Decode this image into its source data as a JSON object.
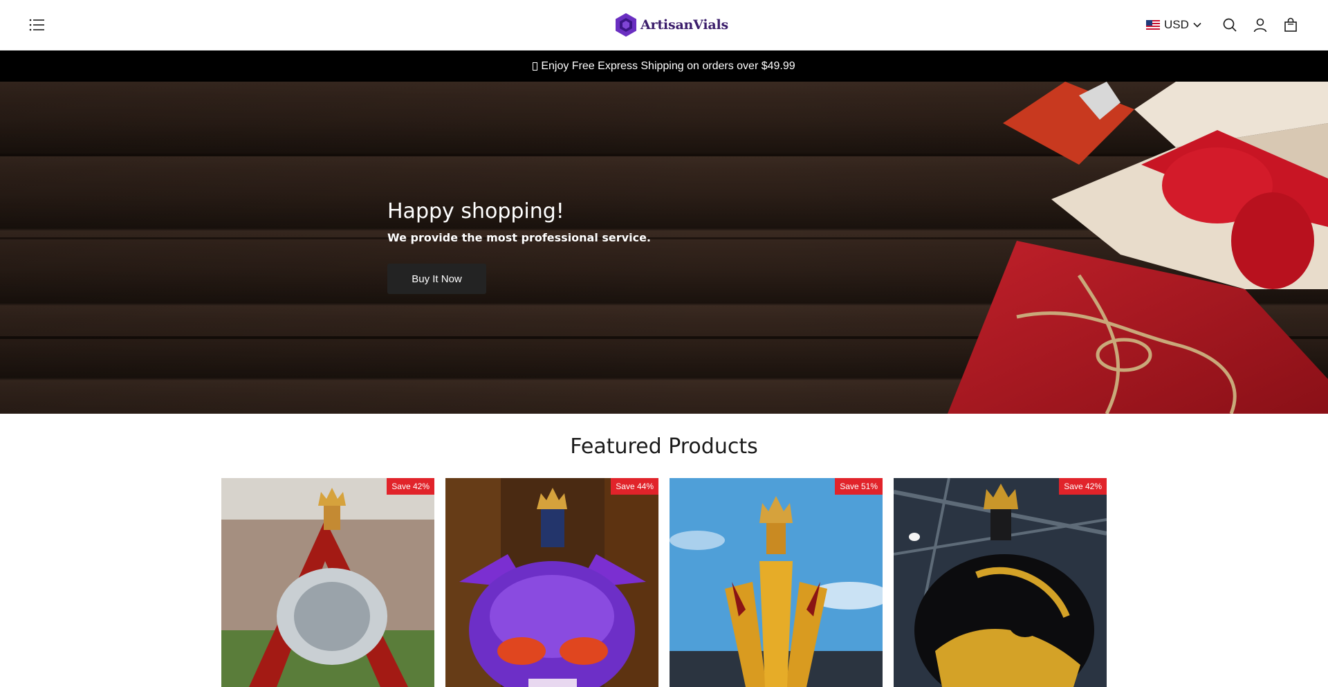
{
  "header": {
    "logo_text": "ArtisanVials",
    "currency": "USD",
    "icons": [
      "menu-icon",
      "us-flag-icon",
      "chevron-down-icon",
      "search-icon",
      "account-icon",
      "cart-icon"
    ]
  },
  "announcement": {
    "text": "Enjoy Free Express Shipping on orders over $49.99"
  },
  "hero": {
    "title": "Happy shopping!",
    "subtitle": "We provide the most professional service.",
    "button_label": "Buy It Now"
  },
  "featured": {
    "title": "Featured Products",
    "products": [
      {
        "badge": "Save 42%"
      },
      {
        "badge": "Save 44%"
      },
      {
        "badge": "Save 51%"
      },
      {
        "badge": "Save 42%"
      }
    ]
  },
  "colors": {
    "logo_purple": "#6a2fc1",
    "announcement_bg": "#000000",
    "badge_red": "#e1232a",
    "button_bg": "#232323"
  }
}
